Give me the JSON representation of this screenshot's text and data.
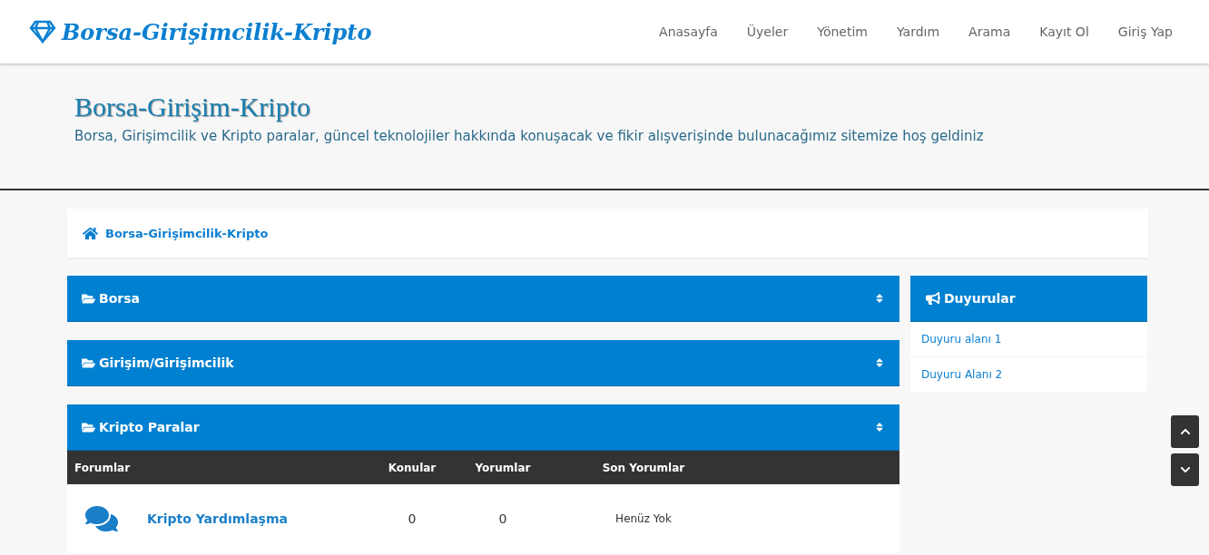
{
  "navbar": {
    "brand": "Borsa-Girişimcilik-Kripto",
    "links": [
      "Anasayfa",
      "Üyeler",
      "Yönetim",
      "Yardım",
      "Arama",
      "Kayıt Ol",
      "Giriş Yap"
    ]
  },
  "hero": {
    "title": "Borsa-Girişim-Kripto",
    "subtitle": "Borsa, Girişimcilik ve Kripto paralar, güncel teknolojiler hakkında konuşacak ve fikir alışverişinde bulunacağımız sitemize hoş geldiniz"
  },
  "breadcrumb": "Borsa-Girişimcilik-Kripto",
  "categories": [
    {
      "name": "Borsa"
    },
    {
      "name": "Girişim/Girişimcilik"
    },
    {
      "name": "Kripto Paralar",
      "columns": [
        "Forumlar",
        "Konular",
        "Yorumlar",
        "Son Yorumlar"
      ],
      "forums": [
        {
          "name": "Kripto Yardımlaşma",
          "topics": "0",
          "comments": "0",
          "last": "Henüz Yok"
        }
      ]
    }
  ],
  "announcements": {
    "title": "Duyurular",
    "items": [
      "Duyuru alanı 1",
      "Duyuru Alanı 2"
    ]
  }
}
